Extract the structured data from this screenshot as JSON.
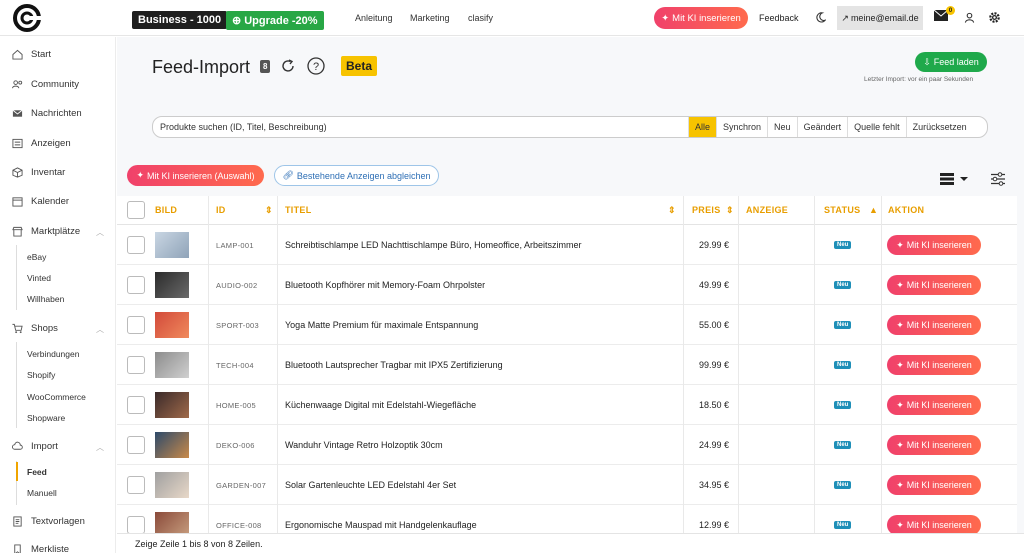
{
  "header": {
    "business_badge": "Business - 1000",
    "upgrade_badge": "Upgrade -20%",
    "nav": [
      "Anleitung",
      "Marketing",
      "clasify"
    ],
    "ki_button": "Mit KI inserieren",
    "feedback": "Feedback",
    "email": "meine@email.de",
    "mail_count": "0"
  },
  "sidebar": {
    "items": [
      {
        "label": "Start",
        "icon": "home-icon"
      },
      {
        "label": "Community",
        "icon": "users-icon"
      },
      {
        "label": "Nachrichten",
        "icon": "mail-icon"
      },
      {
        "label": "Anzeigen",
        "icon": "list-icon"
      },
      {
        "label": "Inventar",
        "icon": "box-icon"
      },
      {
        "label": "Kalender",
        "icon": "calendar-icon"
      },
      {
        "label": "Marktplätze",
        "icon": "store-icon"
      },
      {
        "label": "Shops",
        "icon": "cart-icon"
      },
      {
        "label": "Import",
        "icon": "cloud-icon"
      },
      {
        "label": "Textvorlagen",
        "icon": "doc-icon"
      },
      {
        "label": "Merkliste",
        "icon": "bookmark-icon"
      }
    ],
    "marketplaces": [
      "eBay",
      "Vinted",
      "Willhaben"
    ],
    "shops": [
      "Verbindungen",
      "Shopify",
      "WooCommerce",
      "Shopware"
    ],
    "import": [
      "Feed",
      "Manuell"
    ]
  },
  "page": {
    "title": "Feed-Import",
    "count": "8",
    "beta": "Beta",
    "feed_button": "Feed laden",
    "last_import": "Letzter Import: vor ein paar Sekunden"
  },
  "search": {
    "placeholder": "Produkte suchen (ID, Titel, Beschreibung)",
    "filters": [
      "Alle",
      "Synchron",
      "Neu",
      "Geändert",
      "Quelle fehlt",
      "Zurücksetzen"
    ]
  },
  "actions": {
    "ki_selection": "Mit KI inserieren (Auswahl)",
    "match": "Bestehende Anzeigen abgleichen"
  },
  "table": {
    "headers": [
      "BILD",
      "ID",
      "TITEL",
      "PREIS",
      "ANZEIGE",
      "STATUS",
      "AKTION"
    ],
    "rows": [
      {
        "id": "LAMP-001",
        "title": "Schreibtischlampe LED Nachttischlampe Büro, Homeoffice, Arbeitszimmer",
        "price": "29.99 €",
        "status": "Neu",
        "action": "Mit KI inserieren"
      },
      {
        "id": "AUDIO-002",
        "title": "Bluetooth Kopfhörer mit Memory-Foam Ohrpolster",
        "price": "49.99 €",
        "status": "Neu",
        "action": "Mit KI inserieren"
      },
      {
        "id": "SPORT-003",
        "title": "Yoga Matte Premium für maximale Entspannung",
        "price": "55.00 €",
        "status": "Neu",
        "action": "Mit KI inserieren"
      },
      {
        "id": "TECH-004",
        "title": "Bluetooth Lautsprecher Tragbar mit IPX5 Zertifizierung",
        "price": "99.99 €",
        "status": "Neu",
        "action": "Mit KI inserieren"
      },
      {
        "id": "HOME-005",
        "title": "Küchenwaage Digital mit Edelstahl-Wiegefläche",
        "price": "18.50 €",
        "status": "Neu",
        "action": "Mit KI inserieren"
      },
      {
        "id": "DEKO-006",
        "title": "Wanduhr Vintage Retro Holzoptik 30cm",
        "price": "24.99 €",
        "status": "Neu",
        "action": "Mit KI inserieren"
      },
      {
        "id": "GARDEN-007",
        "title": "Solar Gartenleuchte LED Edelstahl 4er Set",
        "price": "34.95 €",
        "status": "Neu",
        "action": "Mit KI inserieren"
      },
      {
        "id": "OFFICE-008",
        "title": "Ergonomische Mauspad mit Handgelenkauflage",
        "price": "12.99 €",
        "status": "Neu",
        "action": "Mit KI inserieren"
      }
    ]
  },
  "footer": "Zeige Zeile 1 bis 8 von 8 Zeilen."
}
